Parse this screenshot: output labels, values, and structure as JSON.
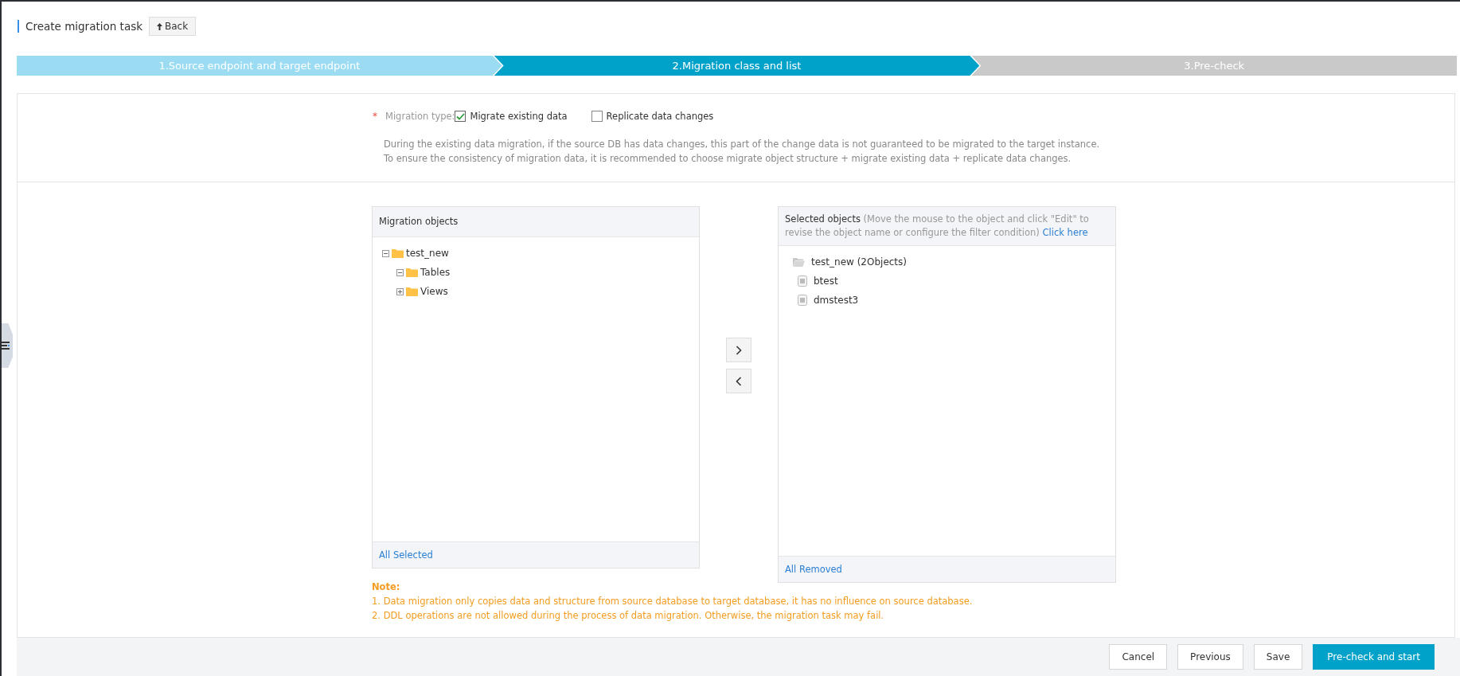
{
  "page_title": "Create migration task",
  "back_button": "Back",
  "steps": [
    {
      "label": "1.Source endpoint and target endpoint",
      "selected": false,
      "completed": true
    },
    {
      "label": "2.Migration class and list",
      "selected": true,
      "completed": false
    },
    {
      "label": "3.Pre-check",
      "selected": false,
      "completed": false
    }
  ],
  "migration_type": {
    "required_mark": "*",
    "label": "Migration type:",
    "options": [
      {
        "label": "Migrate existing data",
        "checked": true
      },
      {
        "label": "Replicate data changes",
        "checked": false
      }
    ],
    "description": [
      "During the existing data migration, if the source DB has data changes, this part of the change data is not guaranteed to be migrated to the target instance.",
      "To ensure the consistency of migration data, it is recommended to choose migrate object structure + migrate existing data + replicate data changes."
    ]
  },
  "source_panel": {
    "title": "Migration objects",
    "tree": [
      {
        "label": "test_new",
        "expanded": true,
        "children": [
          {
            "label": "Tables",
            "expanded": true
          },
          {
            "label": "Views",
            "expanded": false
          }
        ]
      }
    ],
    "footer_link": "All Selected"
  },
  "target_panel": {
    "title": "Selected objects",
    "hint": "(Move the mouse to the object and click \"Edit\" to revise the object name or configure the filter condition)",
    "link": "Click here",
    "items": [
      {
        "label": "test_new (2Objects)",
        "kind": "folder"
      },
      {
        "label": "btest",
        "kind": "table"
      },
      {
        "label": "dmstest3",
        "kind": "table"
      }
    ],
    "footer_link": "All Removed"
  },
  "note": {
    "title": "Note:",
    "lines": [
      "1. Data migration only copies data and structure from source database to target database, it has no influence on source database.",
      "2. DDL operations are not allowed during the process of data migration. Otherwise, the migration task may fail."
    ]
  },
  "footer_buttons": [
    {
      "label": "Cancel",
      "kind": "default"
    },
    {
      "label": "Previous",
      "kind": "default"
    },
    {
      "label": "Save",
      "kind": "default"
    },
    {
      "label": "Pre-check and start",
      "kind": "primary"
    }
  ]
}
